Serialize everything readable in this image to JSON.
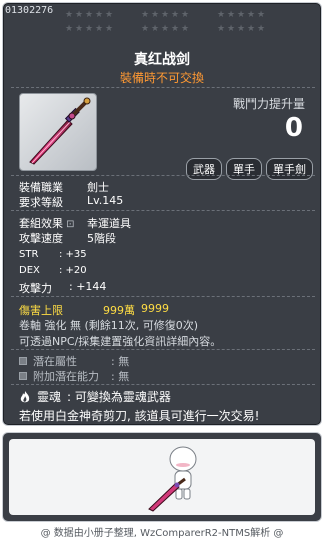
{
  "item": {
    "id": "01302276",
    "name": "真红战剑",
    "trade_note": "裝備時不可交換",
    "stars": {
      "rows": 2,
      "groups_per_row": 3,
      "stars_per_group": 5,
      "filled": 0
    }
  },
  "combat": {
    "label": "戰鬥力提升量",
    "value": "0"
  },
  "tags": [
    "武器",
    "單手",
    "單手劍"
  ],
  "requirements": [
    {
      "label": "裝備職業",
      "value": "劍士"
    },
    {
      "label": "要求等級",
      "value": "Lv.145"
    }
  ],
  "set_effect": {
    "label": "套組效果",
    "value": "幸運道具",
    "icon": "lock-icon"
  },
  "attack_speed": {
    "label": "攻擊速度",
    "value": "5階段"
  },
  "stats": [
    {
      "label": "STR",
      "value": ": +35"
    },
    {
      "label": "DEX",
      "value": ": +20"
    }
  ],
  "attack": {
    "label": "攻擊力",
    "value": ": +144"
  },
  "damage_limit": {
    "label": "傷害上限",
    "value1": "999萬",
    "value2": "9999"
  },
  "upgrade_text": "卷軸 強化 無 (剩餘11次, 可修復0次)",
  "transfer_text": "可透過NPC/採集建置強化資訊詳細內容。",
  "potentials": [
    {
      "label": "潛在屬性",
      "value": ": 無",
      "icon": "potential-icon"
    },
    {
      "label": "附加潛在能力",
      "value": ": 無",
      "icon": "additional-potential-icon"
    }
  ],
  "soul": {
    "label": "靈魂",
    "value": ": 可變換為靈魂武器",
    "icon": "flame-icon"
  },
  "scissors_text": "若使用白金神奇剪刀, 該道具可進行一次交易!",
  "footer": "@ 数据由小册子整理, WzComparerR2-NTMS解析 @",
  "colors": {
    "trade_note": "#ff9933",
    "damage_limit": "#ffdd44",
    "panel": "#3a3e45"
  }
}
